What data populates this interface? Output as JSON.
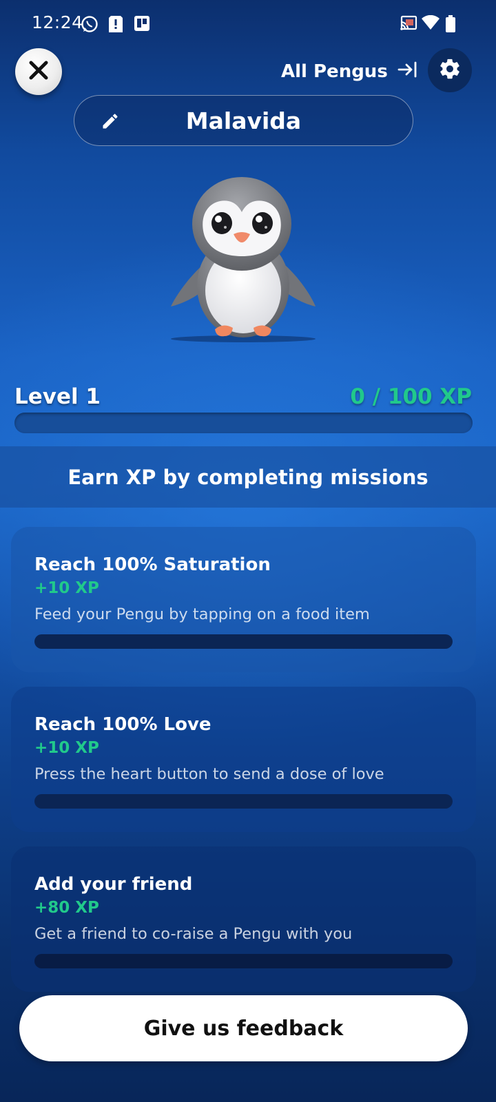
{
  "status_bar": {
    "time": "12:24",
    "left_icons": [
      "whatsapp-icon",
      "alert-icon",
      "trello-icon"
    ],
    "right_icons": [
      "cast-icon",
      "wifi-icon",
      "battery-icon"
    ]
  },
  "header": {
    "close_icon": "close-icon",
    "all_pengus_label": "All Pengus",
    "all_pengus_icon": "arrow-to-bar-icon",
    "settings_icon": "gear-icon"
  },
  "pengu": {
    "name": "Malavida",
    "edit_icon": "pencil-icon"
  },
  "level": {
    "label": "Level 1",
    "xp_text": "0 / 100 XP",
    "progress": 0
  },
  "missions": {
    "title": "Earn XP by completing missions",
    "items": [
      {
        "title": "Reach 100% Saturation",
        "reward": "+10 XP",
        "description": "Feed your Pengu by tapping on a food item",
        "progress": 0
      },
      {
        "title": "Reach 100% Love",
        "reward": "+10 XP",
        "description": "Press the heart button to send a dose of love",
        "progress": 0
      },
      {
        "title": "Add your friend",
        "reward": "+80 XP",
        "description": "Get a friend to co-raise a Pengu with you",
        "progress": 0
      }
    ]
  },
  "feedback_button": {
    "label": "Give us feedback"
  },
  "colors": {
    "accent_green": "#21c98b",
    "background_top": "#0c2f6e",
    "background_mid": "#1b66c8",
    "background_bottom": "#082659"
  }
}
